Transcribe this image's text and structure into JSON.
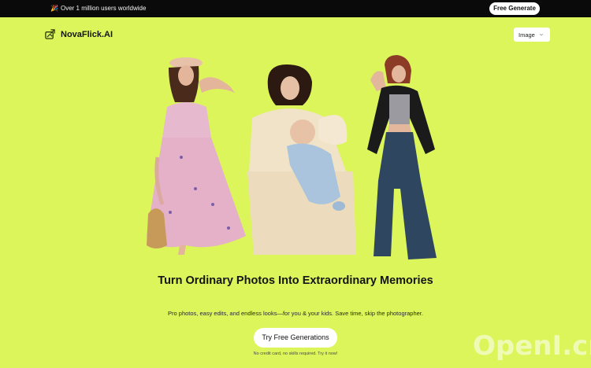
{
  "topbar": {
    "announcement": "Over 1 million users worldwide",
    "party_icon": "party-popper-icon",
    "cta_label": "Free Generate"
  },
  "header": {
    "brand": "NovaFlick.AI",
    "select_value": "Image"
  },
  "hero": {
    "headline": "Turn Ordinary Photos Into Extraordinary Memories",
    "subtitle": "Pro photos, easy edits, and endless looks—for you & your kids. Save time, skip the photographer.",
    "cta_label": "Try Free Generations",
    "note": "No credit card, no skills required. Try it now!"
  },
  "watermark": "OpenI.cn",
  "colors": {
    "background": "#dcf55a",
    "topbar": "#0a0a0a",
    "button": "#ffffff"
  }
}
